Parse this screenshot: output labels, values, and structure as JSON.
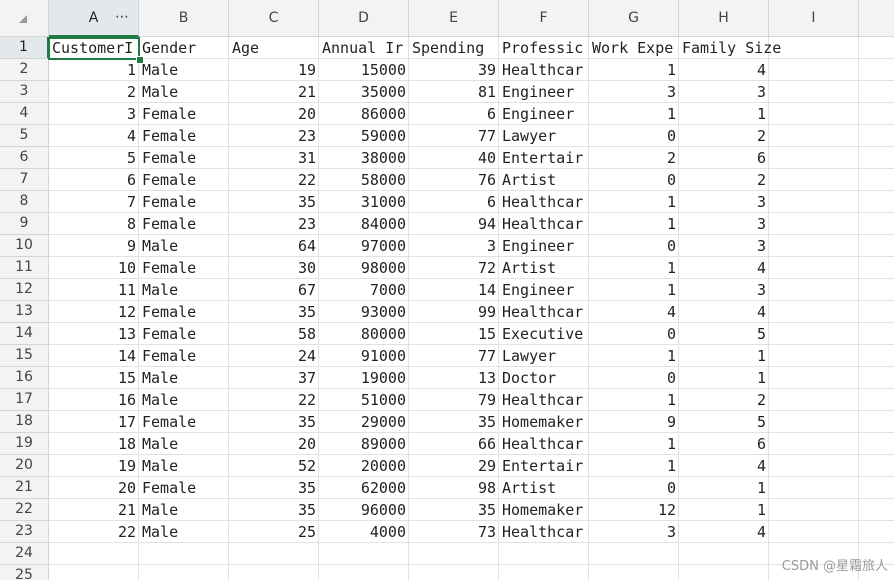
{
  "columns": [
    "A",
    "B",
    "C",
    "D",
    "E",
    "F",
    "G",
    "H",
    "I"
  ],
  "column_menu_glyph": "⋯",
  "row_numbers": [
    "1",
    "2",
    "3",
    "4",
    "5",
    "6",
    "7",
    "8",
    "9",
    "10",
    "11",
    "12",
    "13",
    "14",
    "15",
    "16",
    "17",
    "18",
    "19",
    "20",
    "21",
    "22",
    "23",
    "24",
    "25"
  ],
  "selected_cell": "A1",
  "header_row": [
    "CustomerI",
    "Gender",
    "Age",
    "Annual Ir",
    "Spending",
    "Professic",
    "Work Expe",
    "Family Size"
  ],
  "rows": [
    [
      "1",
      "Male",
      "19",
      "15000",
      "39",
      "Healthcar",
      "1",
      "4"
    ],
    [
      "2",
      "Male",
      "21",
      "35000",
      "81",
      "Engineer",
      "3",
      "3"
    ],
    [
      "3",
      "Female",
      "20",
      "86000",
      "6",
      "Engineer",
      "1",
      "1"
    ],
    [
      "4",
      "Female",
      "23",
      "59000",
      "77",
      "Lawyer",
      "0",
      "2"
    ],
    [
      "5",
      "Female",
      "31",
      "38000",
      "40",
      "Entertair",
      "2",
      "6"
    ],
    [
      "6",
      "Female",
      "22",
      "58000",
      "76",
      "Artist",
      "0",
      "2"
    ],
    [
      "7",
      "Female",
      "35",
      "31000",
      "6",
      "Healthcar",
      "1",
      "3"
    ],
    [
      "8",
      "Female",
      "23",
      "84000",
      "94",
      "Healthcar",
      "1",
      "3"
    ],
    [
      "9",
      "Male",
      "64",
      "97000",
      "3",
      "Engineer",
      "0",
      "3"
    ],
    [
      "10",
      "Female",
      "30",
      "98000",
      "72",
      "Artist",
      "1",
      "4"
    ],
    [
      "11",
      "Male",
      "67",
      "7000",
      "14",
      "Engineer",
      "1",
      "3"
    ],
    [
      "12",
      "Female",
      "35",
      "93000",
      "99",
      "Healthcar",
      "4",
      "4"
    ],
    [
      "13",
      "Female",
      "58",
      "80000",
      "15",
      "Executive",
      "0",
      "5"
    ],
    [
      "14",
      "Female",
      "24",
      "91000",
      "77",
      "Lawyer",
      "1",
      "1"
    ],
    [
      "15",
      "Male",
      "37",
      "19000",
      "13",
      "Doctor",
      "0",
      "1"
    ],
    [
      "16",
      "Male",
      "22",
      "51000",
      "79",
      "Healthcar",
      "1",
      "2"
    ],
    [
      "17",
      "Female",
      "35",
      "29000",
      "35",
      "Homemaker",
      "9",
      "5"
    ],
    [
      "18",
      "Male",
      "20",
      "89000",
      "66",
      "Healthcar",
      "1",
      "6"
    ],
    [
      "19",
      "Male",
      "52",
      "20000",
      "29",
      "Entertair",
      "1",
      "4"
    ],
    [
      "20",
      "Female",
      "35",
      "62000",
      "98",
      "Artist",
      "0",
      "1"
    ],
    [
      "21",
      "Male",
      "35",
      "96000",
      "35",
      "Homemaker",
      "12",
      "1"
    ],
    [
      "22",
      "Male",
      "25",
      "4000",
      "73",
      "Healthcar",
      "3",
      "4"
    ]
  ],
  "column_types": [
    "num",
    "txt",
    "num",
    "num",
    "num",
    "txt",
    "num",
    "num"
  ],
  "watermark": "CSDN @星霜旅人",
  "colors": {
    "header_bg": "#f3f3f3",
    "active_header_bg": "#e3e8ec",
    "selection": "#1f7a44",
    "gridline": "#e2e2e2",
    "text": "#222222"
  }
}
